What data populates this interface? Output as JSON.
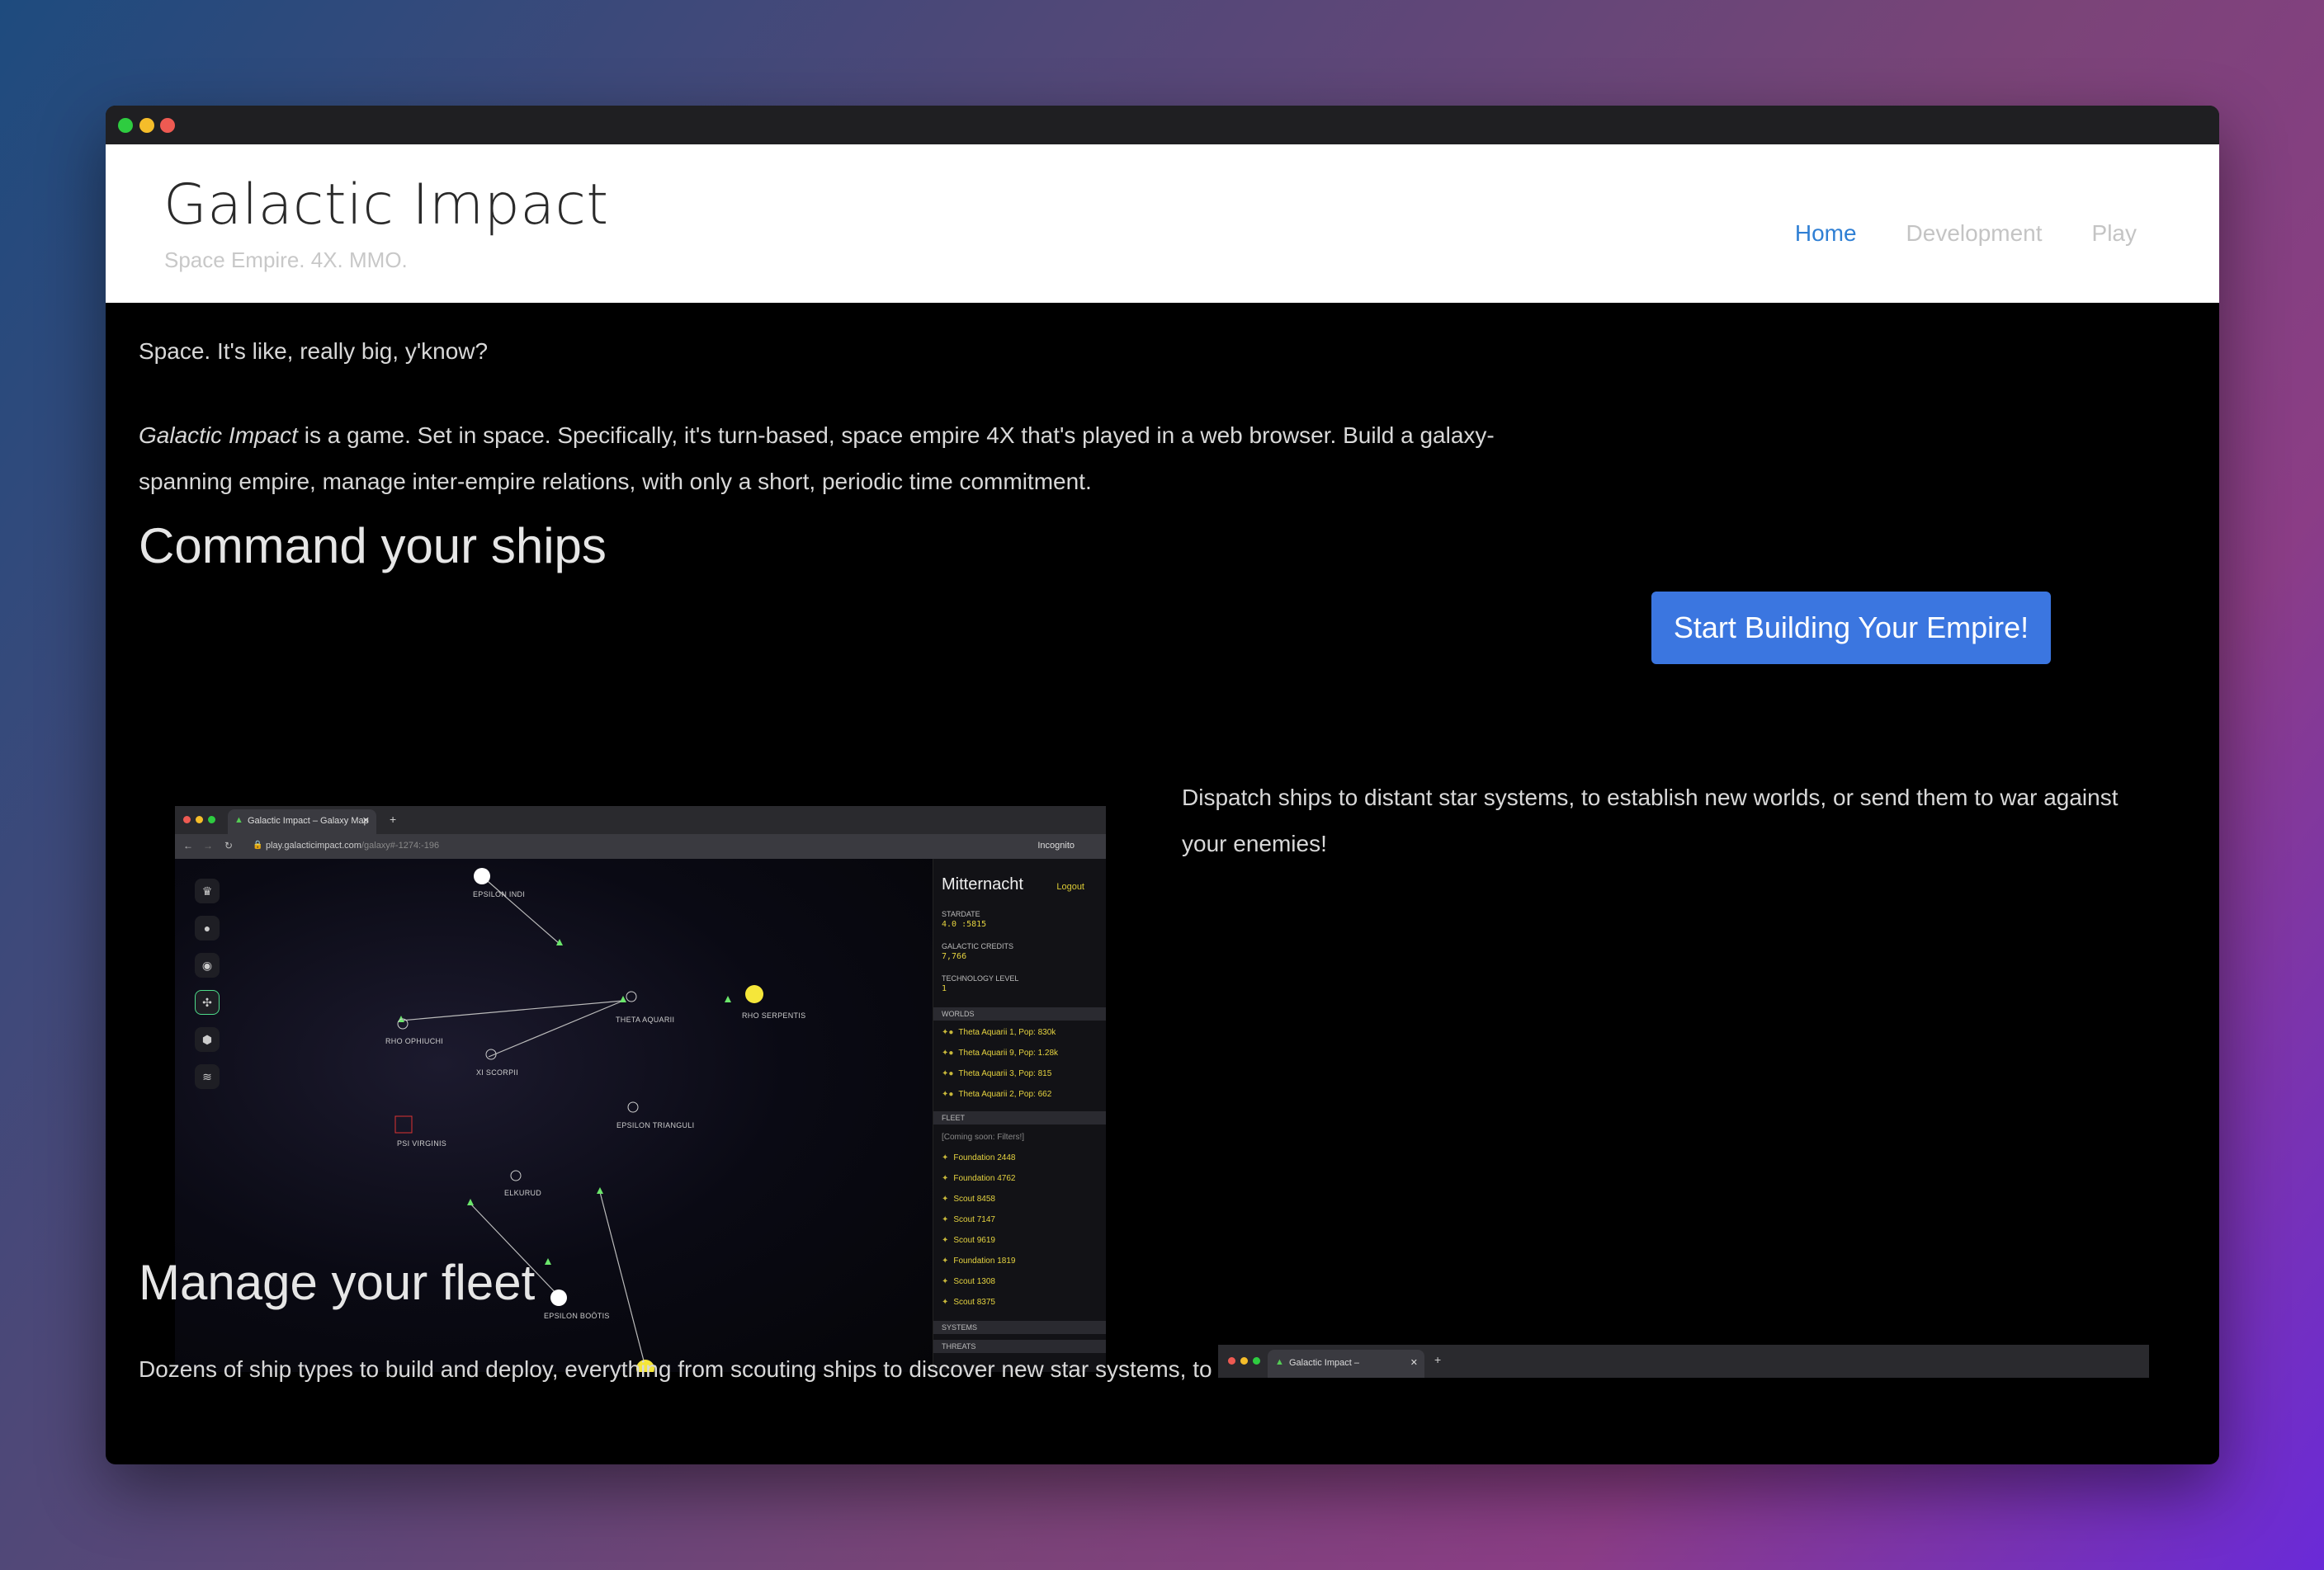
{
  "site": {
    "title": "Galactic Impact",
    "tagline": "Space Empire. 4X. MMO."
  },
  "nav": {
    "items": [
      {
        "label": "Home",
        "active": true
      },
      {
        "label": "Development",
        "active": false
      },
      {
        "label": "Play",
        "active": false
      }
    ]
  },
  "intro": {
    "tagline": "Space. It's like, really big, y'know?",
    "game_name": "Galactic Impact",
    "description_rest": " is a game. Set in space. Specifically, it's turn-based, space empire 4X that's played in a web browser. Build a galaxy-spanning empire, manage inter-empire relations, with only a short, periodic time commitment."
  },
  "cta": {
    "label": "Start Building Your Empire!"
  },
  "section_ships": {
    "heading": "Command your ships",
    "description": "Dispatch ships to distant star systems, to establish new worlds, or send them to war against your enemies!"
  },
  "section_fleet": {
    "heading": "Manage your fleet",
    "description": "Dozens of ship types to build and deploy, everything from scouting ships to discover new star systems, to"
  },
  "game_screenshot": {
    "tab_title": "Galactic Impact – Galaxy Map",
    "url_host": "play.galacticimpact.com",
    "url_path": "/galaxy#-1274:-196",
    "incognito": "Incognito",
    "player_name": "Mitternacht",
    "logout": "Logout",
    "stardate_label": "STARDATE",
    "stardate_value": "4.0 :5815",
    "credits_label": "GALACTIC CREDITS",
    "credits_value": "7,766",
    "tech_label": "TECHNOLOGY LEVEL",
    "tech_value": "1",
    "worlds_label": "WORLDS",
    "worlds": [
      "Theta Aquarii 1, Pop: 830k",
      "Theta Aquarii 9, Pop: 1.28k",
      "Theta Aquarii 3, Pop: 815",
      "Theta Aquarii 2, Pop: 662"
    ],
    "fleet_label": "FLEET",
    "fleet_note": "[Coming soon: Filters!]",
    "fleet": [
      "Foundation 2448",
      "Foundation 4762",
      "Scout 8458",
      "Scout 7147",
      "Scout 9619",
      "Foundation 1819",
      "Scout 1308",
      "Scout 8375"
    ],
    "systems_label": "SYSTEMS",
    "threats_label": "THREATS",
    "star_labels": [
      "EPSILON INDI",
      "RHO OPHIUCHI",
      "THETA AQUARII",
      "RHO SERPENTIS",
      "XI SCORPII",
      "EPSILON TRIANGULI",
      "PSI VIRGINIS",
      "ELKURUD",
      "EPSILON BOÖTIS"
    ]
  },
  "game_screenshot_2": {
    "tab_title": "Galactic Impact –"
  },
  "colors": {
    "accent": "#3b76e0",
    "nav_active": "#2f7fd4",
    "game_yellow": "#e5d340"
  }
}
